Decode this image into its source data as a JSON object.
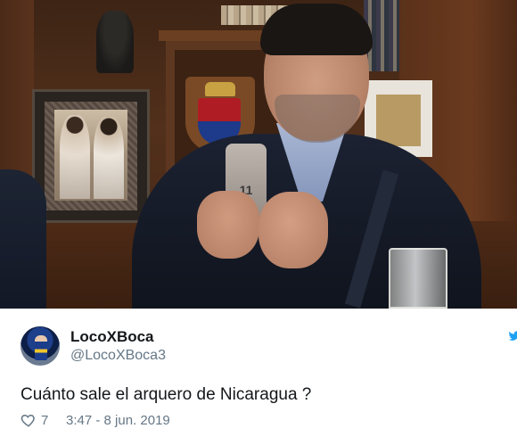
{
  "photo": {
    "phone_case_number": "11"
  },
  "tweet": {
    "display_name": "LocoXBoca",
    "handle": "@LocoXBoca3",
    "text": "Cuánto sale el arquero de Nicaragua ?",
    "like_count": "7",
    "time": "3:47",
    "separator": " - ",
    "date": "8 jun. 2019",
    "icons": {
      "like": "heart-outline-icon",
      "brand": "twitter-bird-icon"
    },
    "colors": {
      "name": "#14171a",
      "meta": "#657786",
      "brand": "#1da1f2"
    }
  }
}
